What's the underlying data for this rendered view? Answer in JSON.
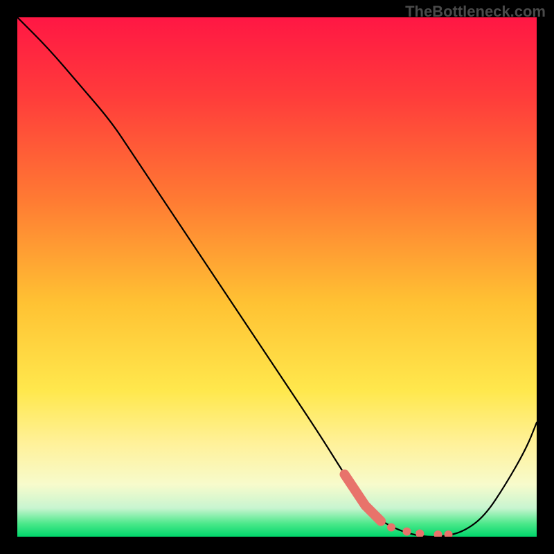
{
  "watermark": "TheBottleneck.com",
  "chart_data": {
    "type": "line",
    "title": "",
    "xlabel": "",
    "ylabel": "",
    "xlim": [
      0,
      100
    ],
    "ylim": [
      0,
      100
    ],
    "gradient_stops": [
      {
        "offset": 0.0,
        "color": "#ff1744"
      },
      {
        "offset": 0.15,
        "color": "#ff3b3b"
      },
      {
        "offset": 0.35,
        "color": "#ff7a33"
      },
      {
        "offset": 0.55,
        "color": "#ffc233"
      },
      {
        "offset": 0.72,
        "color": "#ffe84d"
      },
      {
        "offset": 0.82,
        "color": "#fff199"
      },
      {
        "offset": 0.9,
        "color": "#f7fbcc"
      },
      {
        "offset": 0.945,
        "color": "#c8f5d0"
      },
      {
        "offset": 0.975,
        "color": "#4be88a"
      },
      {
        "offset": 1.0,
        "color": "#00d66b"
      }
    ],
    "series": [
      {
        "name": "bottleneck-curve",
        "color": "#000000",
        "x": [
          0,
          6,
          12,
          18,
          22,
          26,
          34,
          42,
          50,
          58,
          63,
          67,
          70,
          74,
          78,
          82,
          86,
          90,
          94,
          98,
          100
        ],
        "y": [
          100,
          94,
          87,
          80,
          74,
          68,
          56,
          44,
          32,
          20,
          12,
          6,
          3,
          1,
          0,
          0,
          1,
          4,
          10,
          17,
          22
        ]
      }
    ],
    "highlight_segment": {
      "color": "#e8736b",
      "width_thick": 14,
      "x": [
        63,
        67,
        70
      ],
      "y": [
        12,
        6,
        3
      ]
    },
    "highlight_dots": {
      "color": "#e8736b",
      "radius": 6,
      "points": [
        {
          "x": 72,
          "y": 1.8
        },
        {
          "x": 75,
          "y": 1.0
        },
        {
          "x": 77.5,
          "y": 0.6
        },
        {
          "x": 81,
          "y": 0.4
        },
        {
          "x": 83,
          "y": 0.4
        }
      ]
    }
  }
}
